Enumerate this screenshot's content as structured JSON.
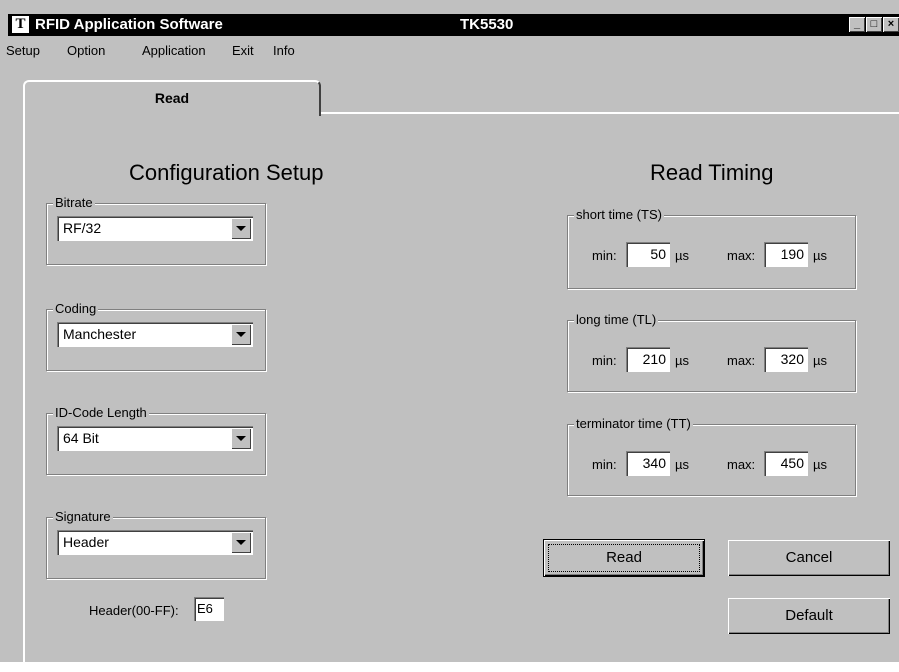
{
  "window": {
    "title": "RFID Application Software",
    "model": "TK5530",
    "logo_letter": "T",
    "controls": [
      "_",
      "□",
      "×"
    ]
  },
  "menu": {
    "items": [
      "Setup",
      "Option",
      "Application",
      "Exit",
      "Info"
    ]
  },
  "tab": {
    "label": "Read"
  },
  "config": {
    "title": "Configuration Setup",
    "bitrate": {
      "label": "Bitrate",
      "value": "RF/32"
    },
    "coding": {
      "label": "Coding",
      "value": "Manchester"
    },
    "id_length": {
      "label": "ID-Code Length",
      "value": "64 Bit"
    },
    "signature": {
      "label": "Signature",
      "value": "Header"
    },
    "header": {
      "label": "Header(00-FF):",
      "value": "E6"
    }
  },
  "timing": {
    "title": "Read Timing",
    "min_label": "min:",
    "max_label": "max:",
    "unit": "µs",
    "short": {
      "label": "short time (TS)",
      "min": "50",
      "max": "190"
    },
    "long": {
      "label": "long time (TL)",
      "min": "210",
      "max": "320"
    },
    "terminator": {
      "label": "terminator time (TT)",
      "min": "340",
      "max": "450"
    }
  },
  "buttons": {
    "read": "Read",
    "cancel": "Cancel",
    "default": "Default"
  },
  "icons": {
    "combo_arrow": "chevron-down-icon",
    "minimize": "minimize-icon",
    "maximize": "maximize-icon",
    "close": "close-icon"
  }
}
